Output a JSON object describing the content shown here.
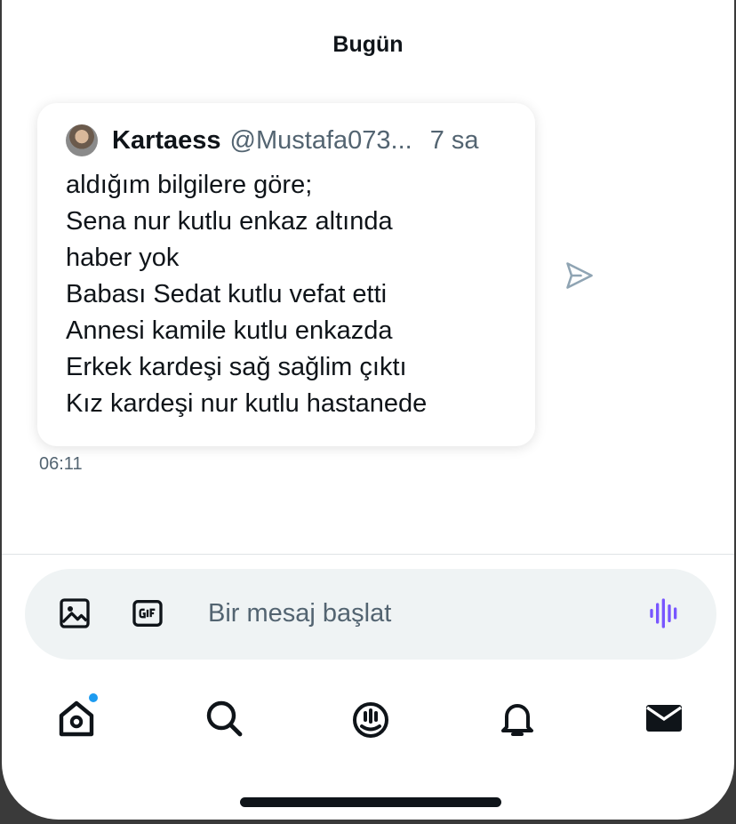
{
  "conversation": {
    "date_header": "Bugün"
  },
  "message": {
    "tweet": {
      "author_name": "Kartaess",
      "author_handle": "@Mustafa073...",
      "age": "7 sa",
      "lines": [
        "aldığım bilgilere göre;",
        "Sena nur kutlu enkaz altında",
        "haber yok",
        "Babası Sedat kutlu vefat etti",
        "Annesi kamile kutlu enkazda",
        "Erkek kardeşi sağ sağlim çıktı",
        "Kız kardeşi nur kutlu hastanede"
      ]
    },
    "time": "06:11"
  },
  "composer": {
    "placeholder": "Bir mesaj başlat"
  },
  "colors": {
    "text_primary": "#0f1419",
    "text_secondary": "#536471",
    "composer_bg": "#eff3f4",
    "voice_accent": "#7856ff",
    "notification_dot": "#1d9bf0"
  },
  "icons": {
    "share": "paper-plane-icon",
    "composer": [
      "image-icon",
      "gif-icon",
      "voice-message-icon"
    ],
    "nav": [
      "home-icon",
      "search-icon",
      "spaces-icon",
      "notifications-bell-icon",
      "messages-envelope-icon"
    ]
  }
}
